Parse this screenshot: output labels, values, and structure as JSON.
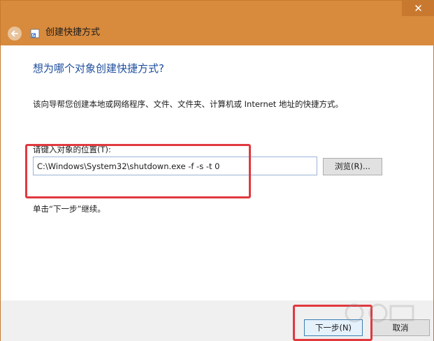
{
  "window": {
    "close_glyph": "✕"
  },
  "header": {
    "title": "创建快捷方式",
    "back_icon": "back-arrow-icon",
    "app_icon": "shortcut-icon"
  },
  "main": {
    "heading": "想为哪个对象创建快捷方式?",
    "description": "该向导帮您创建本地或网络程序、文件、文件夹、计算机或 Internet 地址的快捷方式。",
    "location_label": "请键入对象的位置(T):",
    "location_value": "C:\\Windows\\System32\\shutdown.exe -f -s -t 0",
    "browse_label": "浏览(R)...",
    "hint": "单击“下一步”继续。"
  },
  "footer": {
    "next_label": "下一步(N)",
    "cancel_label": "取消"
  },
  "colors": {
    "titlebar": "#d88a3d",
    "heading": "#1d4e9e",
    "highlight": "#e0393e"
  }
}
